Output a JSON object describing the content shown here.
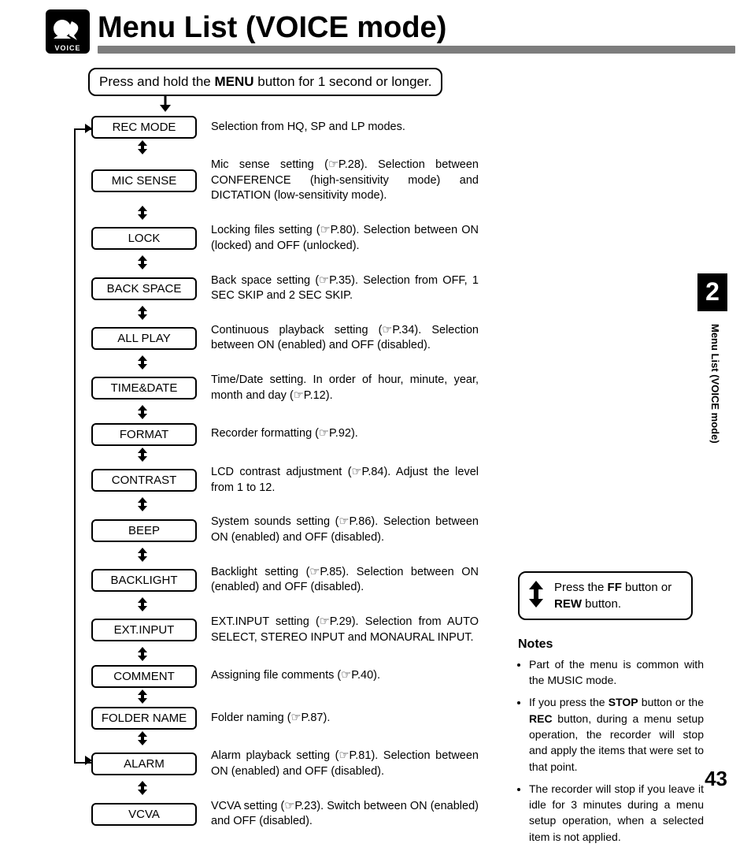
{
  "header": {
    "icon_label": "VOICE",
    "title": "Menu List  (VOICE mode)"
  },
  "top_instruction": {
    "prefix": "Press and hold the ",
    "bold": "MENU",
    "suffix": " button for 1 second or longer."
  },
  "menu_items": [
    {
      "name": "REC MODE",
      "desc": "Selection from  HQ, SP and LP modes."
    },
    {
      "name": "MIC SENSE",
      "desc": "Mic sense setting (☞P.28). Selection between CONFERENCE (high-sensitivity mode) and DICTATION (low-sensitivity mode)."
    },
    {
      "name": "LOCK",
      "desc": "Locking files setting (☞P.80). Selection between ON (locked) and OFF (unlocked)."
    },
    {
      "name": "BACK SPACE",
      "desc": "Back space setting (☞P.35). Selection from OFF, 1 SEC SKIP and 2 SEC SKIP."
    },
    {
      "name": "ALL PLAY",
      "desc": "Continuous playback setting (☞P.34). Selection between ON (enabled) and OFF (disabled)."
    },
    {
      "name": "TIME&DATE",
      "desc": "Time/Date setting. In order of hour, minute, year, month and day (☞P.12)."
    },
    {
      "name": "FORMAT",
      "desc": "Recorder formatting (☞P.92)."
    },
    {
      "name": "CONTRAST",
      "desc": "LCD contrast adjustment  (☞P.84). Adjust the level from 1 to 12."
    },
    {
      "name": "BEEP",
      "desc": "System sounds setting (☞P.86). Selection between ON (enabled) and OFF (disabled)."
    },
    {
      "name": "BACKLIGHT",
      "desc": "Backlight setting (☞P.85). Selection between ON (enabled) and OFF (disabled)."
    },
    {
      "name": "EXT.INPUT",
      "desc": "EXT.INPUT setting (☞P.29). Selection from AUTO SELECT, STEREO INPUT and MONAURAL INPUT."
    },
    {
      "name": "COMMENT",
      "desc": "Assigning file comments (☞P.40)."
    },
    {
      "name": "FOLDER NAME",
      "desc": "Folder naming (☞P.87)."
    },
    {
      "name": "ALARM",
      "desc": "Alarm playback setting (☞P.81). Selection between ON (enabled) and OFF (disabled)."
    },
    {
      "name": "VCVA",
      "desc": "VCVA setting (☞P.23).  Switch between ON (enabled) and OFF (disabled)."
    }
  ],
  "right": {
    "chapter": "2",
    "side_title": "Menu List  (VOICE mode)",
    "ff_box": {
      "prefix": "Press the ",
      "b1": "FF",
      "mid": " button or ",
      "b2": "REW",
      "suffix": " button."
    },
    "notes_head": "Notes",
    "notes": [
      {
        "text": "Part of the menu is common with the MUSIC mode."
      },
      {
        "text_html": "If you press the <b>STOP</b> button or the <b>REC</b> button, during a menu setup operation, the recorder will stop and apply the items that were set to that point."
      },
      {
        "text": "The recorder will stop if you leave it idle for 3 minutes during a menu setup operation, when a selected item is not applied."
      }
    ]
  },
  "page_number": "43"
}
